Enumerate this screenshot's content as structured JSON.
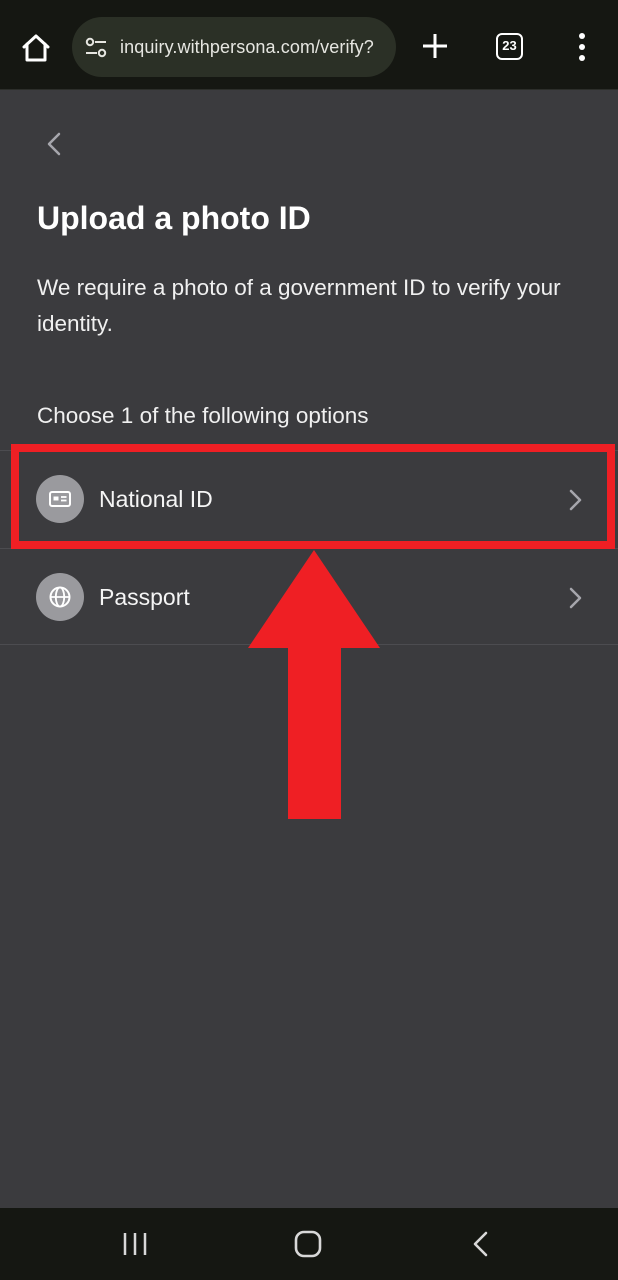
{
  "browser": {
    "url": "inquiry.withpersona.com/verify?",
    "tab_count": "23"
  },
  "page": {
    "title": "Upload a photo ID",
    "description": "We require a photo of a government ID to verify your identity.",
    "choose_label": "Choose 1 of the following options"
  },
  "options": [
    {
      "label": "National ID",
      "icon": "id-card-icon"
    },
    {
      "label": "Passport",
      "icon": "globe-icon"
    }
  ],
  "annotation": {
    "color": "#ef1f24",
    "highlighted_option": "National ID"
  },
  "colors": {
    "background": "#3b3b3e",
    "browser_bar": "#151712",
    "url_pill": "#2b3026",
    "icon_badge": "#9a9a9e"
  }
}
